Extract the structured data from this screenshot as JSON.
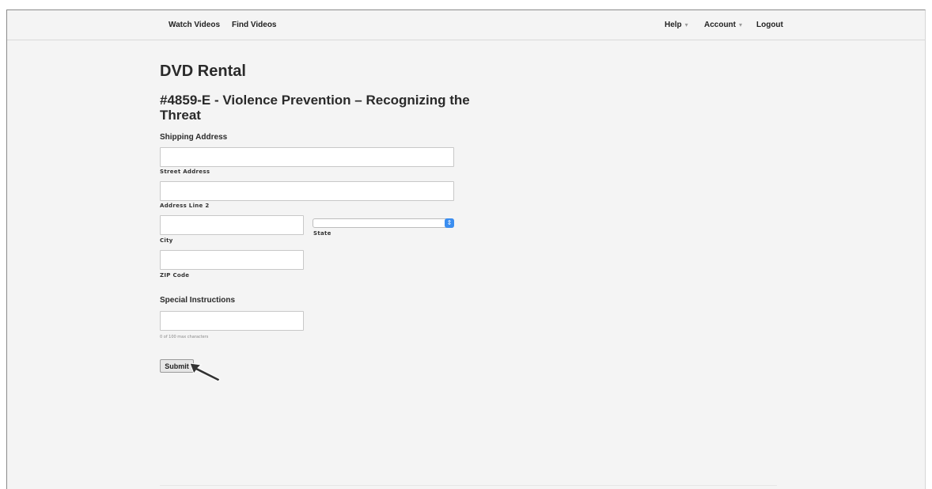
{
  "nav": {
    "watch_videos": "Watch Videos",
    "find_videos": "Find Videos",
    "help": "Help",
    "account": "Account",
    "logout": "Logout"
  },
  "page": {
    "title": "DVD Rental",
    "video_title": "#4859-E - Violence Prevention – Recognizing the Threat"
  },
  "shipping": {
    "heading": "Shipping Address",
    "street_label": "Street Address",
    "street_value": "",
    "line2_label": "Address Line 2",
    "line2_value": "",
    "city_label": "City",
    "city_value": "",
    "state_label": "State",
    "state_value": "",
    "zip_label": "ZIP Code",
    "zip_value": ""
  },
  "instructions": {
    "heading": "Special Instructions",
    "value": "",
    "char_count": "0 of 100 max characters"
  },
  "form": {
    "submit_label": "Submit"
  },
  "icons": {
    "caret": "▾",
    "select_arrow": "⇕"
  },
  "colors": {
    "background": "#f4f4f4",
    "select_accent": "#3b8ef0",
    "pointer": "#333333"
  }
}
